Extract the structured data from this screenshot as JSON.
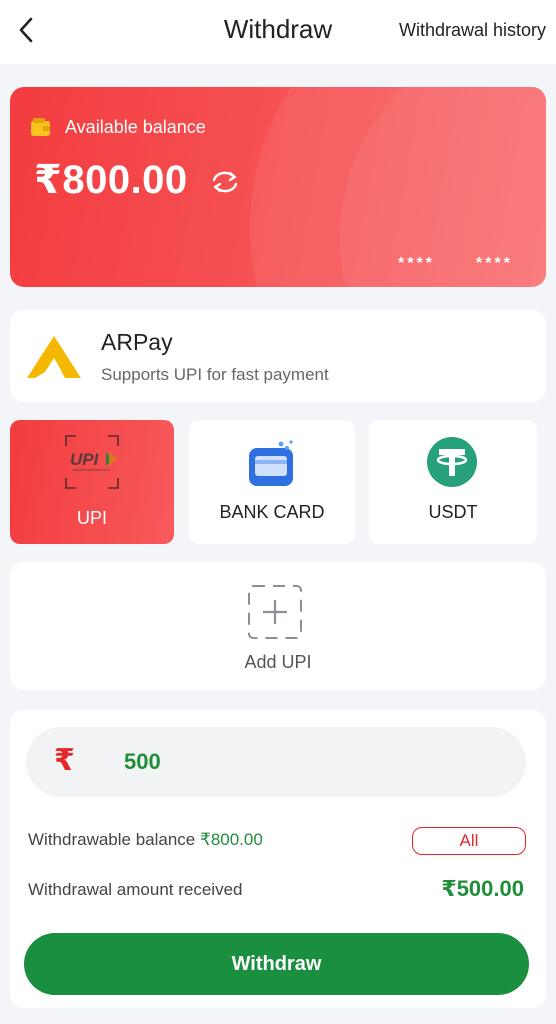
{
  "header": {
    "title": "Withdraw",
    "history_link": "Withdrawal history",
    "back_icon": "chevron-left-icon"
  },
  "balance_card": {
    "label": "Available balance",
    "amount": "₹800.00",
    "mask_1": "****",
    "mask_2": "****",
    "colors": {
      "start": "#f33c3f",
      "end": "#fa6a6b"
    }
  },
  "provider": {
    "name": "ARPay",
    "description": "Supports UPI for fast payment",
    "logo_color": "#f5b800"
  },
  "methods": [
    {
      "label": "UPI",
      "icon": "upi-logo-icon",
      "selected": true
    },
    {
      "label": "BANK CARD",
      "icon": "bank-card-icon",
      "selected": false
    },
    {
      "label": "USDT",
      "icon": "tether-icon",
      "selected": false
    }
  ],
  "add_account": {
    "label": "Add UPI",
    "icon": "plus-icon"
  },
  "form": {
    "currency_symbol": "₹",
    "amount_value": "500",
    "withdrawable_label": "Withdrawable balance",
    "withdrawable_value": "₹800.00",
    "all_button": "All",
    "received_label": "Withdrawal amount received",
    "received_value": "₹500.00",
    "submit_button": "Withdraw"
  },
  "colors": {
    "accent_red": "#e5262b",
    "accent_green": "#1a8f3f",
    "usdt_green": "#26a17b",
    "bank_blue": "#2f6fe0"
  }
}
